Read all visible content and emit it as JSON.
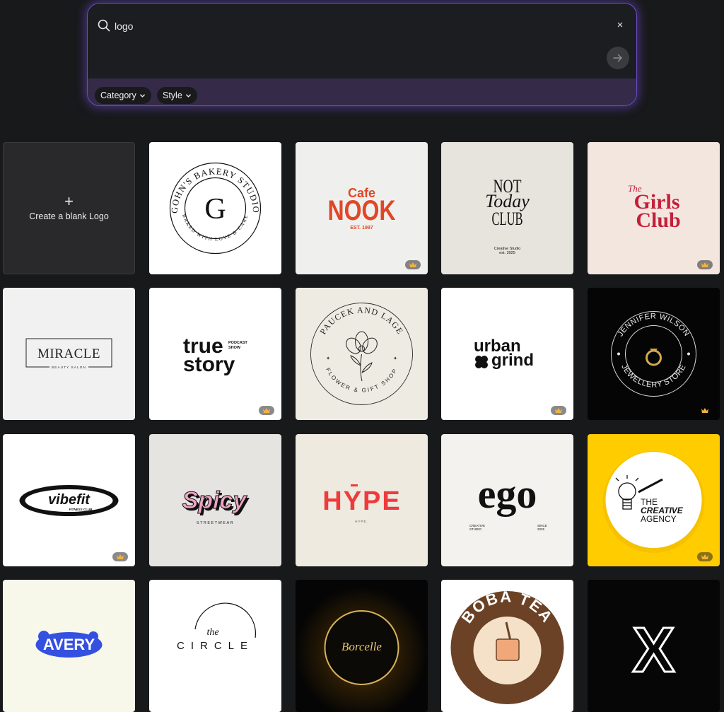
{
  "search": {
    "value": "logo",
    "clear_label": "×",
    "submit_label": "→"
  },
  "filters": [
    {
      "label": "Category"
    },
    {
      "label": "Style"
    }
  ],
  "blank_card": {
    "plus": "+",
    "label": "Create a blank Logo"
  },
  "icons": [
    "search-icon",
    "close-icon",
    "arrow-right-icon",
    "chevron-down-icon",
    "crown-icon"
  ],
  "colors": {
    "accent_glow": "#7b52e6",
    "filter_bar": "#352a48",
    "crown": "#f2b13d"
  },
  "templates": [
    {
      "id": "gohns",
      "texts": {
        "top": "GOHN'S BAKERY STUDIO",
        "letter": "G",
        "bottom": "BAKED WITH LOVE & CARE"
      },
      "premium": false
    },
    {
      "id": "cafe-nook",
      "texts": {
        "script": "Cafe",
        "main": "NOOK",
        "est": "EST. 1997"
      },
      "premium": true
    },
    {
      "id": "not-today",
      "texts": {
        "line1": "NOT",
        "line2": "Today",
        "line3": "CLUB",
        "sub1": "Creative Studio",
        "sub2": "est. 2025"
      },
      "premium": false
    },
    {
      "id": "girls-club",
      "texts": {
        "the": "The",
        "line1": "Girls",
        "line2": "Club"
      },
      "premium": true
    },
    {
      "id": "miracle",
      "texts": {
        "main": "MIRACLE",
        "sub": "BEAUTY SALON"
      },
      "premium": false
    },
    {
      "id": "true-story",
      "texts": {
        "line1": "true",
        "line2": "story",
        "tag1": "PODCAST",
        "tag2": "SHOW"
      },
      "premium": true
    },
    {
      "id": "paucek",
      "texts": {
        "top": "PAUCEK AND LAGE",
        "bottom": "FLOWER & GIFT SHOP"
      },
      "premium": false
    },
    {
      "id": "urban-grind",
      "texts": {
        "line1": "urban",
        "line2": "grind"
      },
      "premium": true
    },
    {
      "id": "jennifer",
      "texts": {
        "top": "JENNIFER WILSON",
        "bottom": "JEWELLERY STORE"
      },
      "premium": true
    },
    {
      "id": "vibefit",
      "texts": {
        "main": "vibefit",
        "sub": "FITNESS CLUB"
      },
      "premium": true
    },
    {
      "id": "spicy",
      "texts": {
        "main": "Spicy",
        "sub": "STREETWEAR"
      },
      "premium": false
    },
    {
      "id": "hype",
      "texts": {
        "main": "HYPE",
        "sub": "HYPE."
      },
      "premium": false
    },
    {
      "id": "ego",
      "texts": {
        "main": "ego",
        "left1": "CREATIVE",
        "left2": "STUDIO",
        "right1": "SINCE",
        "right2": "2025"
      },
      "premium": false
    },
    {
      "id": "creative-agency",
      "texts": {
        "l1": "THE",
        "l2": "CREATIVE",
        "l3": "AGENCY"
      },
      "premium": true
    },
    {
      "id": "avery",
      "texts": {
        "main": "AVERY"
      },
      "premium": false
    },
    {
      "id": "the-circle",
      "texts": {
        "the": "the",
        "main": "CIRCLE"
      },
      "premium": false
    },
    {
      "id": "borcelle",
      "texts": {
        "main": "Borcelle"
      },
      "premium": false
    },
    {
      "id": "boba-tea",
      "texts": {
        "main": "BOBA TEA"
      },
      "premium": false
    },
    {
      "id": "x-logo",
      "texts": {
        "main": "X"
      },
      "premium": false
    }
  ]
}
